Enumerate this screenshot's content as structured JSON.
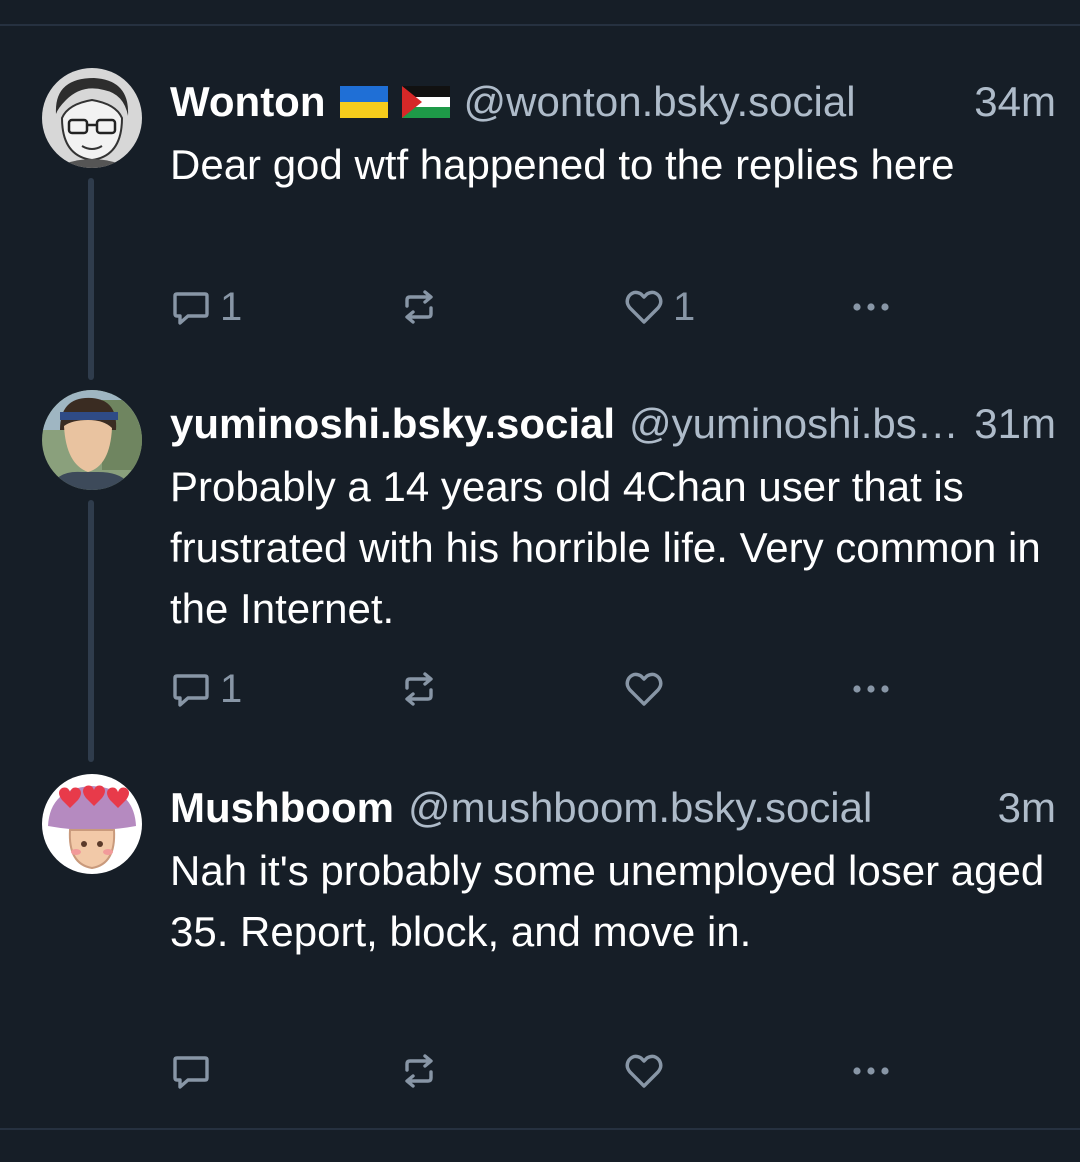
{
  "colors": {
    "background": "#161e27",
    "text": "#ffffff",
    "muted": "#aebbc9",
    "icon": "#8896a6",
    "thread_line": "#2f3c4c"
  },
  "posts": [
    {
      "display_name": "Wonton",
      "flags": [
        "ukraine-flag-icon",
        "palestine-flag-icon"
      ],
      "handle": "@wonton.bsky.social",
      "time": "34m",
      "text": "Dear god wtf happened to the replies here",
      "reply_count": "1",
      "repost_count": "",
      "like_count": "1",
      "avatar": "sketch-avatar-with-glasses"
    },
    {
      "display_name": "yuminoshi.bsky.social",
      "handle": "@yuminoshi.bsky.social",
      "time": "31m",
      "text": "Probably a 14 years old 4Chan user that is frustrated with his horrible life. Very common in the Internet.",
      "reply_count": "1",
      "repost_count": "",
      "like_count": "",
      "avatar": "photo-avatar-headband"
    },
    {
      "display_name": "Mushboom",
      "handle": "@mushboom.bsky.social",
      "time": "3m",
      "text": "Nah it's probably some unemployed loser aged 35. Report, block, and move in.",
      "reply_count": "",
      "repost_count": "",
      "like_count": "",
      "avatar": "mushroom-hearts-avatar"
    }
  ],
  "icons": {
    "reply": "reply-icon",
    "repost": "repost-icon",
    "like": "heart-icon",
    "more": "more-options-icon"
  }
}
